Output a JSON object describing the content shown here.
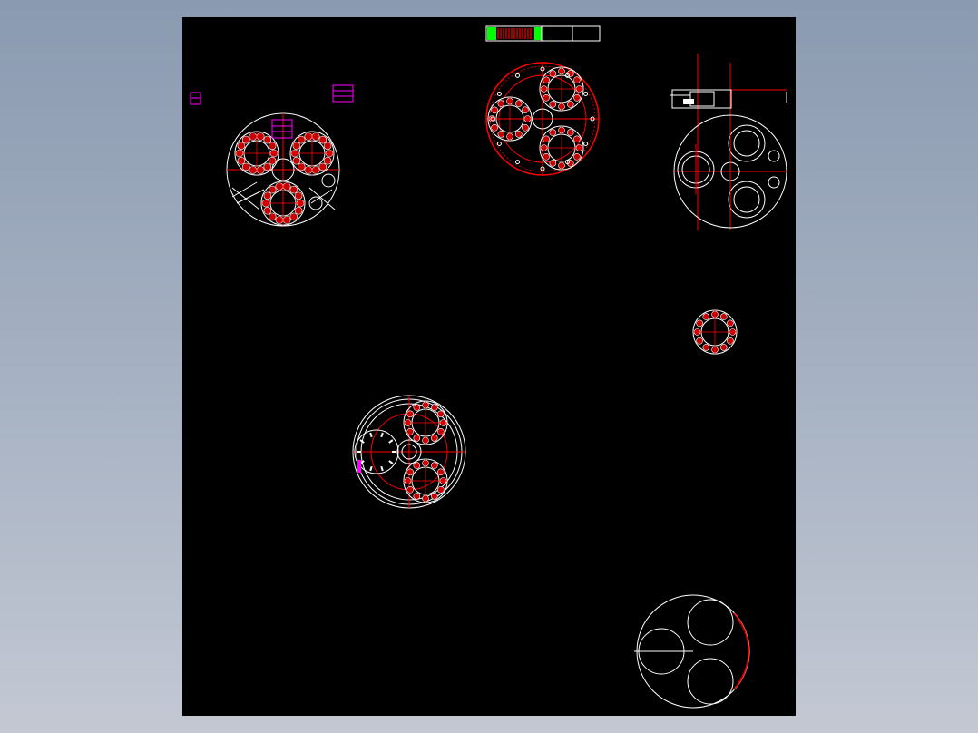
{
  "viewer": {
    "background_top": "#8a9ab0",
    "background_bottom": "#c3c8d3"
  },
  "sheet": {
    "background": "#000000"
  },
  "palette": {
    "outline": "#ffffff",
    "centerline": "#ff0000",
    "hatch": "#c80000",
    "annotation": "#ff00ff",
    "title_green": "#00ff00"
  },
  "views": [
    "planet-carrier-three-bearings-view",
    "gear-assembly-top-view",
    "side-section-view",
    "end-plate-view",
    "single-bearing-detail",
    "planetary-gear-mesh-view",
    "carrier-plate-outline-view"
  ]
}
